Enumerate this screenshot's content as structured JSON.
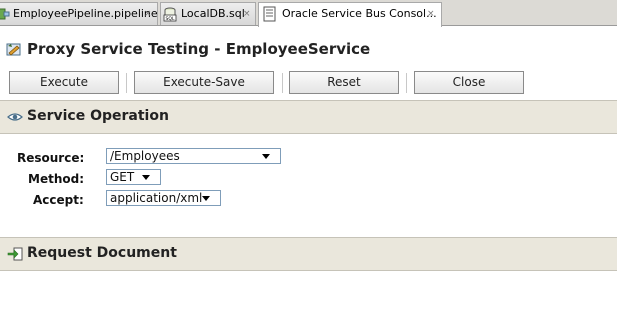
{
  "tabs": [
    {
      "label": "EmployeePipeline.pipeline",
      "close": "×",
      "icon": "pipeline-icon",
      "active": false
    },
    {
      "label": "LocalDB.sql",
      "close": "×",
      "icon": "sql-icon",
      "active": false
    },
    {
      "label": "Oracle Service Bus Consol...",
      "close": "×",
      "icon": "document-icon",
      "active": true
    }
  ],
  "header": {
    "title": "Proxy Service Testing - EmployeeService",
    "icon": "test-console-icon"
  },
  "toolbar": {
    "execute_label": "Execute",
    "execute_save_label": "Execute-Save",
    "reset_label": "Reset",
    "close_label": "Close"
  },
  "service_operation": {
    "title": "Service Operation",
    "icon": "eye-icon",
    "resource": {
      "label": "Resource:",
      "value": "/Employees"
    },
    "method": {
      "label": "Method:",
      "value": "GET"
    },
    "accept": {
      "label": "Accept:",
      "value": "application/xml"
    }
  },
  "request_document": {
    "title": "Request Document",
    "icon": "request-arrow-icon"
  },
  "colors": {
    "section_header_bg": "#eae7dc",
    "field_border": "#7f9db9"
  }
}
